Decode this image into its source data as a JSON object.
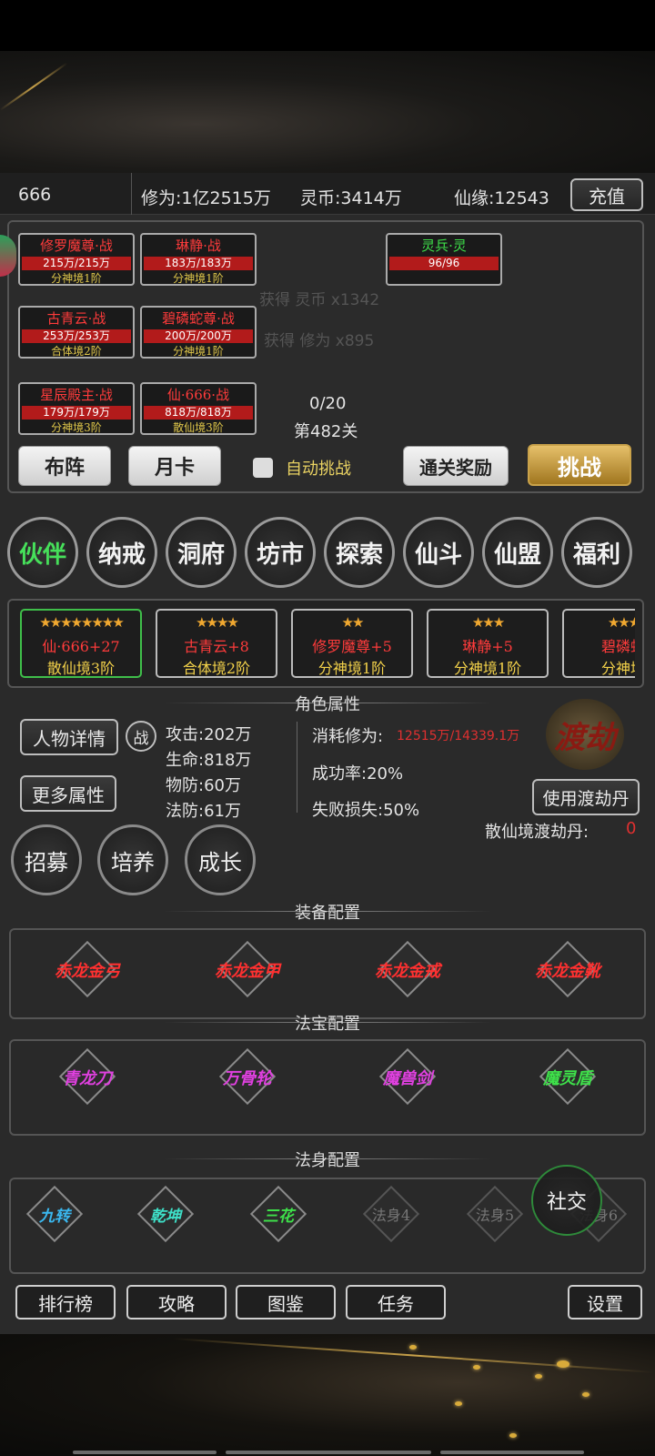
{
  "topbar": {
    "id": "666",
    "xiuwei": "修为:1亿2515万",
    "lingbi": "灵币:3414万",
    "xianyuan": "仙缘:12543",
    "recharge": "充值"
  },
  "battle": {
    "cards": [
      {
        "name": "修罗魔尊·战",
        "hp": "215万/215万",
        "realm": "分神境1阶"
      },
      {
        "name": "琳静·战",
        "hp": "183万/183万",
        "realm": "分神境1阶"
      },
      {
        "name": "古青云·战",
        "hp": "253万/253万",
        "realm": "合体境2阶"
      },
      {
        "name": "碧磷蛇尊·战",
        "hp": "200万/200万",
        "realm": "分神境1阶"
      },
      {
        "name": "星辰殿主·战",
        "hp": "179万/179万",
        "realm": "分神境3阶"
      },
      {
        "name": "仙·666·战",
        "hp": "818万/818万",
        "realm": "散仙境3阶"
      }
    ],
    "enemy": {
      "name": "灵兵·灵",
      "hp": "96/96"
    },
    "log1": "获得 灵币 x1342",
    "log2": "获得 修为 x895",
    "progress": "0/20",
    "stage": "第482关"
  },
  "actions": {
    "formation": "布阵",
    "monthcard": "月卡",
    "auto": "自动挑战",
    "reward": "通关奖励",
    "challenge": "挑战"
  },
  "nav": [
    "伙伴",
    "纳戒",
    "洞府",
    "坊市",
    "探索",
    "仙斗",
    "仙盟",
    "福利"
  ],
  "partners": [
    {
      "stars": "★★★★★★★★",
      "name": "仙·666+27",
      "realm": "散仙境3阶"
    },
    {
      "stars": "★★★★",
      "name": "古青云+8",
      "realm": "合体境2阶"
    },
    {
      "stars": "★★",
      "name": "修罗魔尊+5",
      "realm": "分神境1阶"
    },
    {
      "stars": "★★★",
      "name": "琳静+5",
      "realm": "分神境1阶"
    },
    {
      "stars": "★★★",
      "name": "碧磷蛇",
      "realm": "分神境"
    }
  ],
  "attr": {
    "title": "角色属性",
    "detail": "人物详情",
    "zhan": "战",
    "more": "更多属性",
    "atk": "攻击:202万",
    "hp": "生命:818万",
    "pdef": "物防:60万",
    "mdef": "法防:61万",
    "cost_label": "消耗修为:",
    "cost_val": "12515万/14339.1万",
    "rate": "成功率:20%",
    "loss": "失败损失:50%",
    "dujie": "渡劫",
    "use_pill": "使用渡劫丹",
    "pill_label": "散仙境渡劫丹:",
    "pill_val": "0"
  },
  "train": [
    "招募",
    "培养",
    "成长"
  ],
  "equip": {
    "title": "装备配置",
    "items": [
      "赤龙金弓",
      "赤龙金甲",
      "赤龙金戒",
      "赤龙金靴"
    ]
  },
  "treasure": {
    "title": "法宝配置",
    "items": [
      "青龙刀",
      "万骨轮",
      "魔兽剑",
      "魔灵盾"
    ]
  },
  "body": {
    "title": "法身配置",
    "items": [
      "九转",
      "乾坤",
      "三花",
      "法身4",
      "法身5",
      "法身6"
    ],
    "social": "社交"
  },
  "bottom": {
    "rank": "排行榜",
    "guide": "攻略",
    "atlas": "图鉴",
    "task": "任务",
    "settings": "设置"
  }
}
